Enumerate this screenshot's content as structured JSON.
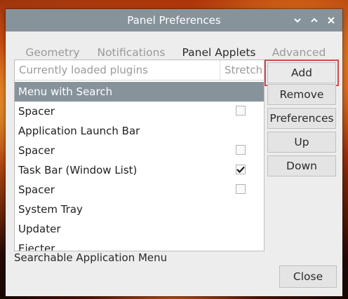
{
  "window": {
    "title": "Panel Preferences"
  },
  "tabs": [
    {
      "label": "Geometry",
      "active": false
    },
    {
      "label": "Notifications",
      "active": false
    },
    {
      "label": "Panel Applets",
      "active": true
    },
    {
      "label": "Advanced",
      "active": false
    }
  ],
  "plugin_list": {
    "header_name": "Currently loaded plugins",
    "header_stretch": "Stretch",
    "rows": [
      {
        "name": "Menu with Search",
        "selected": true,
        "has_checkbox": false,
        "checked": false
      },
      {
        "name": "Spacer",
        "selected": false,
        "has_checkbox": true,
        "checked": false
      },
      {
        "name": "Application Launch Bar",
        "selected": false,
        "has_checkbox": false,
        "checked": false
      },
      {
        "name": "Spacer",
        "selected": false,
        "has_checkbox": true,
        "checked": false
      },
      {
        "name": "Task Bar (Window List)",
        "selected": false,
        "has_checkbox": true,
        "checked": true
      },
      {
        "name": "Spacer",
        "selected": false,
        "has_checkbox": true,
        "checked": false
      },
      {
        "name": "System Tray",
        "selected": false,
        "has_checkbox": false,
        "checked": false
      },
      {
        "name": "Updater",
        "selected": false,
        "has_checkbox": false,
        "checked": false
      },
      {
        "name": "Ejecter",
        "selected": false,
        "has_checkbox": false,
        "checked": false
      }
    ]
  },
  "description": "Searchable Application Menu",
  "buttons": {
    "add": "Add",
    "remove": "Remove",
    "preferences": "Preferences",
    "up": "Up",
    "down": "Down",
    "close": "Close"
  },
  "colors": {
    "accent": "#87939b",
    "focus_highlight": "#d94848"
  }
}
